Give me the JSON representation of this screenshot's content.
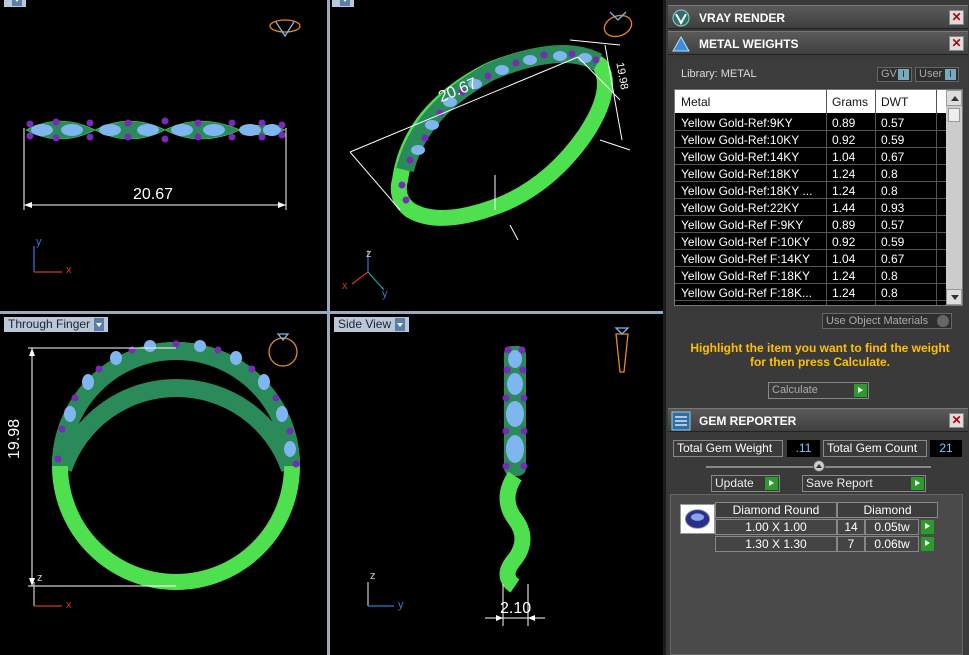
{
  "viewports": {
    "top_left": {
      "label": "",
      "dimension": "20.67"
    },
    "top_right": {
      "label": "",
      "dimension_a": "20.67",
      "dimension_b": "19.98"
    },
    "bottom_left": {
      "label": "Through Finger",
      "dimension": "19.98"
    },
    "bottom_right": {
      "label": "Side View",
      "dimension": "2.10"
    },
    "axes": {
      "x": "x",
      "y": "y",
      "z": "z"
    }
  },
  "vray": {
    "title": "VRAY RENDER",
    "close": "✕"
  },
  "metal": {
    "title": "METAL WEIGHTS",
    "close": "✕",
    "library_label": "Library: METAL",
    "toggle_gv": "GV",
    "toggle_user": "User",
    "toggle_ind": "I",
    "columns": {
      "metal": "Metal",
      "grams": "Grams",
      "dwt": "DWT"
    },
    "rows": [
      {
        "metal": "Yellow Gold-Ref:9KY",
        "grams": "0.89",
        "dwt": "0.57"
      },
      {
        "metal": "Yellow Gold-Ref:10KY",
        "grams": "0.92",
        "dwt": "0.59"
      },
      {
        "metal": "Yellow Gold-Ref:14KY",
        "grams": "1.04",
        "dwt": "0.67"
      },
      {
        "metal": "Yellow Gold-Ref:18KY",
        "grams": "1.24",
        "dwt": "0.8"
      },
      {
        "metal": "Yellow Gold-Ref:18KY ...",
        "grams": "1.24",
        "dwt": "0.8"
      },
      {
        "metal": "Yellow Gold-Ref:22KY",
        "grams": "1.44",
        "dwt": "0.93"
      },
      {
        "metal": "Yellow Gold-Ref F:9KY",
        "grams": "0.89",
        "dwt": "0.57"
      },
      {
        "metal": "Yellow Gold-Ref F:10KY",
        "grams": "0.92",
        "dwt": "0.59"
      },
      {
        "metal": "Yellow Gold-Ref F:14KY",
        "grams": "1.04",
        "dwt": "0.67"
      },
      {
        "metal": "Yellow Gold-Ref F:18KY",
        "grams": "1.24",
        "dwt": "0.8"
      },
      {
        "metal": "Yellow Gold-Ref F:18K...",
        "grams": "1.24",
        "dwt": "0.8"
      }
    ],
    "use_object_materials": "Use Object Materials",
    "hint": "Highlight the item you want to find the weight for then press Calculate.",
    "calculate": "Calculate"
  },
  "gem": {
    "title": "GEM REPORTER",
    "close": "✕",
    "total_weight_label": "Total Gem Weight",
    "total_weight_value": ".11",
    "total_count_label": "Total Gem Count",
    "total_count_value": "21",
    "update": "Update",
    "save_report": "Save Report",
    "shape_header": "Diamond Round",
    "material_header": "Diamond",
    "rows": [
      {
        "size": "1.00 X 1.00",
        "count": "14",
        "weight": "0.05tw"
      },
      {
        "size": "1.30 X 1.30",
        "count": "7",
        "weight": "0.06tw"
      }
    ]
  },
  "colors": {
    "accent": "#ffc000",
    "go": "#2d9a2d",
    "metal_green": "#4ee04e",
    "gem_blue": "#7fb6f0",
    "prong_purple": "#7a2ab8"
  }
}
